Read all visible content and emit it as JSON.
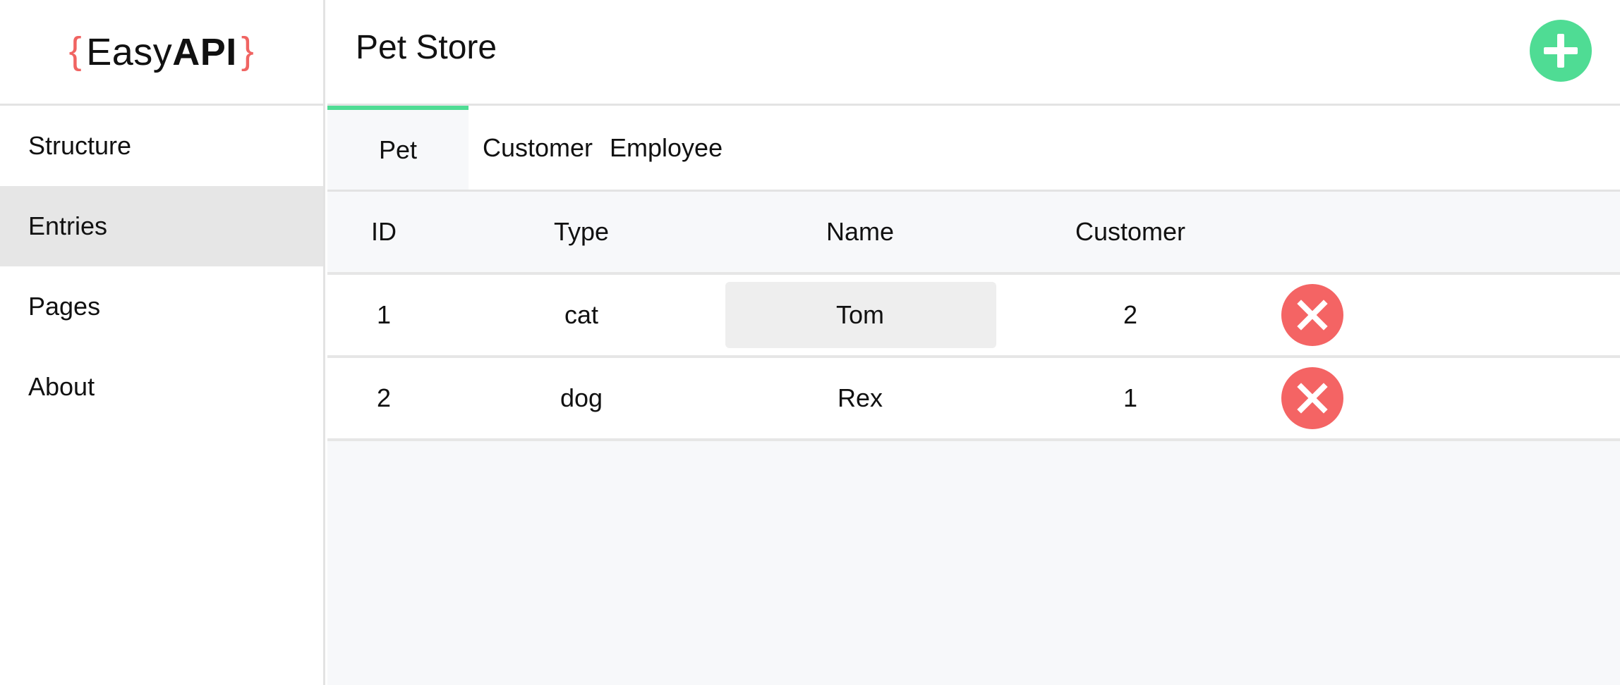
{
  "brand": {
    "open_brace": "{",
    "easy": "Easy",
    "api": "API",
    "close_brace": "}",
    "accent": "#f06462"
  },
  "sidebar": {
    "items": [
      {
        "label": "Structure",
        "active": false
      },
      {
        "label": "Entries",
        "active": true
      },
      {
        "label": "Pages",
        "active": false
      },
      {
        "label": "About",
        "active": false
      }
    ]
  },
  "header": {
    "title": "Pet Store",
    "add_icon": "plus-icon",
    "add_color": "#4fdc94"
  },
  "tabs": [
    {
      "label": "Pet",
      "active": true
    },
    {
      "label": "Customer",
      "active": false
    },
    {
      "label": "Employee",
      "active": false
    }
  ],
  "table": {
    "columns": [
      "ID",
      "Type",
      "Name",
      "Customer"
    ],
    "rows": [
      {
        "id": "1",
        "type": "cat",
        "name": "Tom",
        "customer": "2",
        "name_focused": true
      },
      {
        "id": "2",
        "type": "dog",
        "name": "Rex",
        "customer": "1",
        "name_focused": false
      }
    ],
    "delete_icon": "close-icon",
    "delete_color": "#f46464"
  }
}
